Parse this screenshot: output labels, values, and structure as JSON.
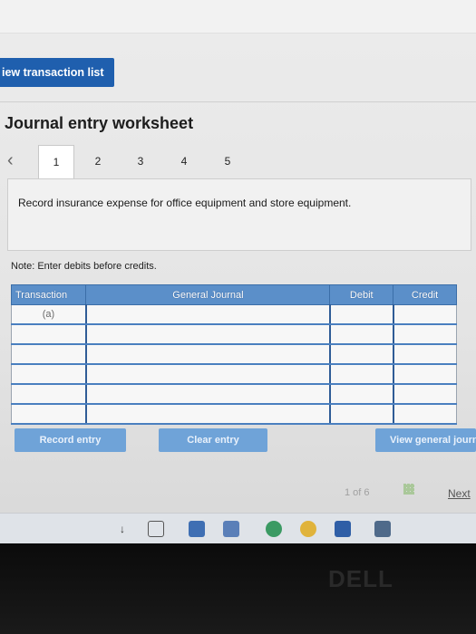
{
  "top": {
    "view_button_label": "iew transaction list"
  },
  "worksheet": {
    "title": "Journal entry worksheet",
    "tabs": [
      "1",
      "2",
      "3",
      "4",
      "5"
    ],
    "instruction": "Record insurance expense for office equipment and store equipment.",
    "note": "Note: Enter debits before credits."
  },
  "table": {
    "headers": [
      "Transaction",
      "General Journal",
      "Debit",
      "Credit"
    ],
    "rows": [
      {
        "transaction": "(a)",
        "account": "",
        "debit": "",
        "credit": ""
      },
      {
        "transaction": "",
        "account": "",
        "debit": "",
        "credit": ""
      },
      {
        "transaction": "",
        "account": "",
        "debit": "",
        "credit": ""
      },
      {
        "transaction": "",
        "account": "",
        "debit": "",
        "credit": ""
      },
      {
        "transaction": "",
        "account": "",
        "debit": "",
        "credit": ""
      },
      {
        "transaction": "",
        "account": "",
        "debit": "",
        "credit": ""
      }
    ]
  },
  "actions": {
    "record": "Record entry",
    "clear": "Clear entry",
    "view_general": "View general journa"
  },
  "pager": {
    "position": "1 of 6",
    "next": "Next"
  },
  "colors": {
    "primary_button": "#1f5fae",
    "table_header": "#5b8fc9",
    "action_button": "#6fa3d8"
  }
}
